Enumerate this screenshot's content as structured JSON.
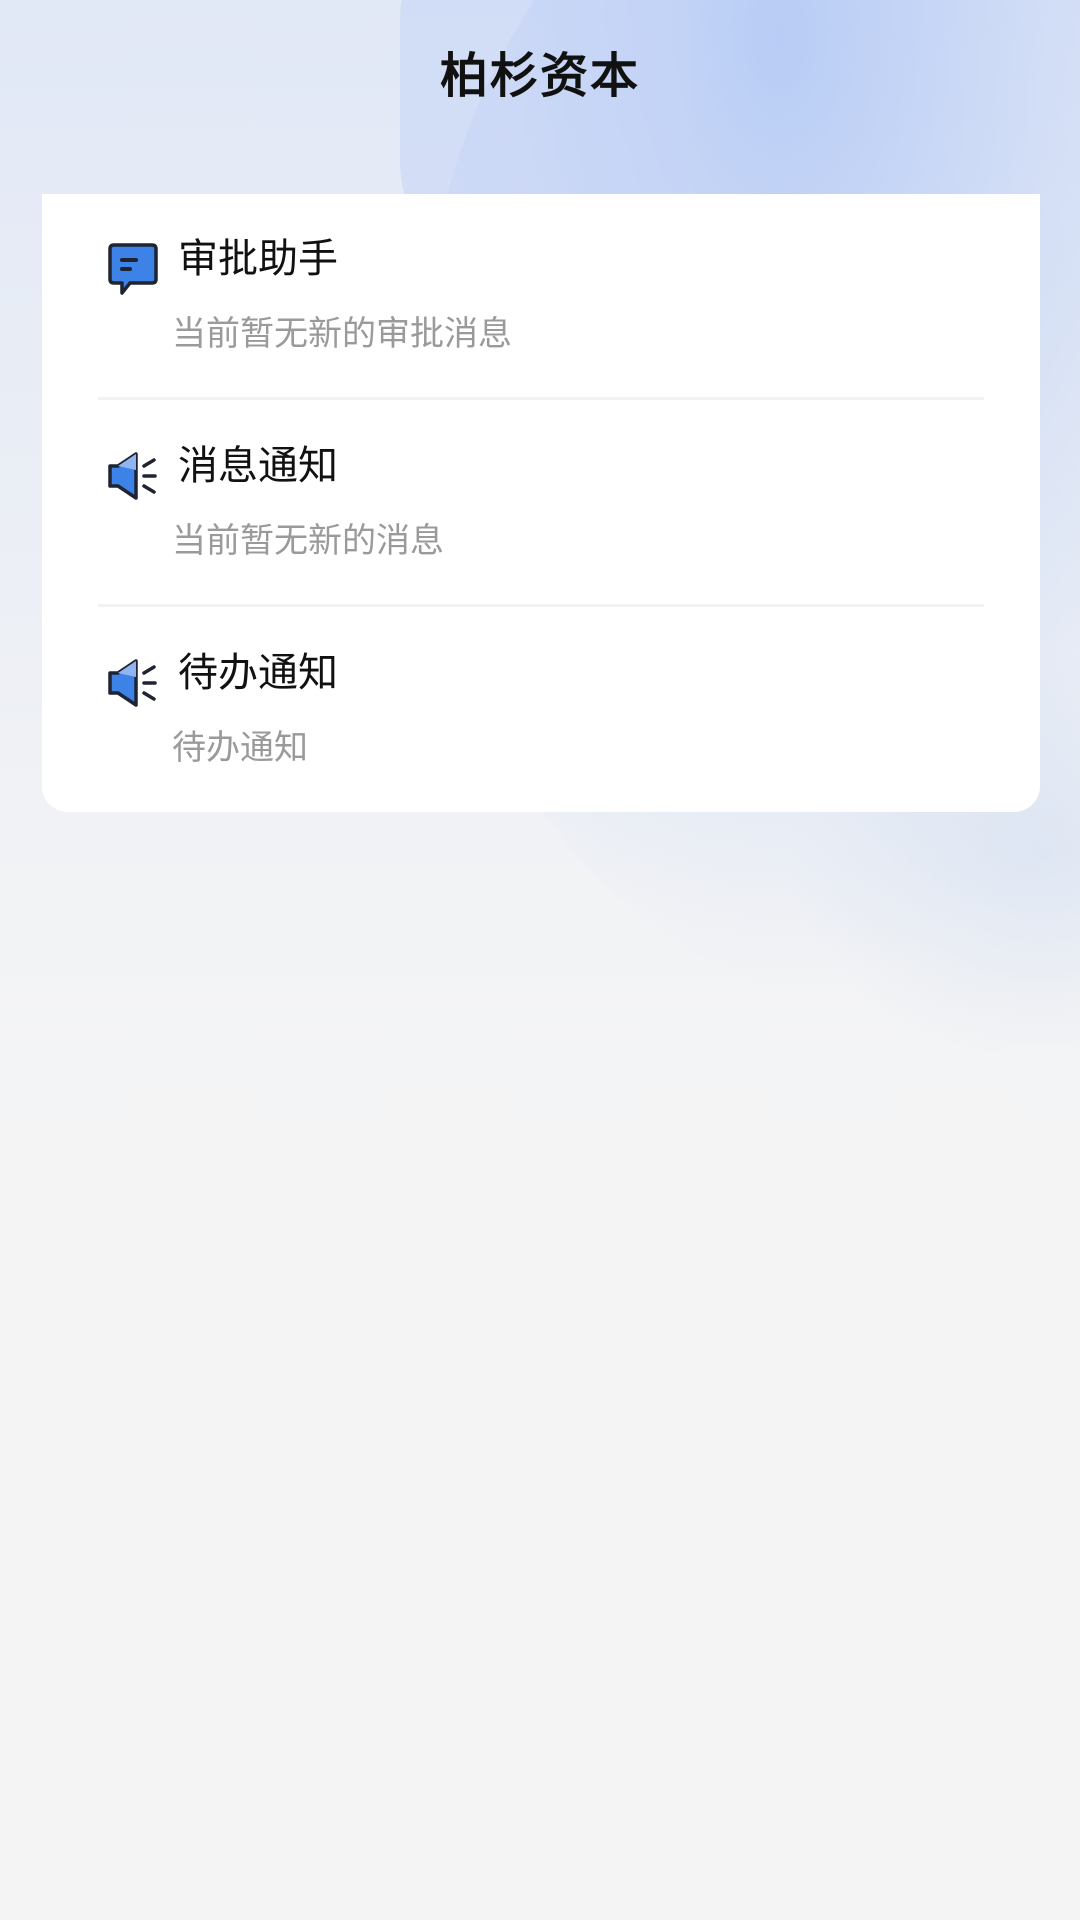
{
  "header": {
    "title": "柏杉资本"
  },
  "items": [
    {
      "icon": "chat-bubble-icon",
      "title": "审批助手",
      "desc": "当前暂无新的审批消息"
    },
    {
      "icon": "speaker-icon",
      "title": "消息通知",
      "desc": "当前暂无新的消息"
    },
    {
      "icon": "speaker-icon",
      "title": "待办通知",
      "desc": "待办通知"
    }
  ],
  "colors": {
    "icon_primary": "#3d82e6",
    "icon_light": "#8fb6f3",
    "icon_outline": "#1f2430"
  }
}
